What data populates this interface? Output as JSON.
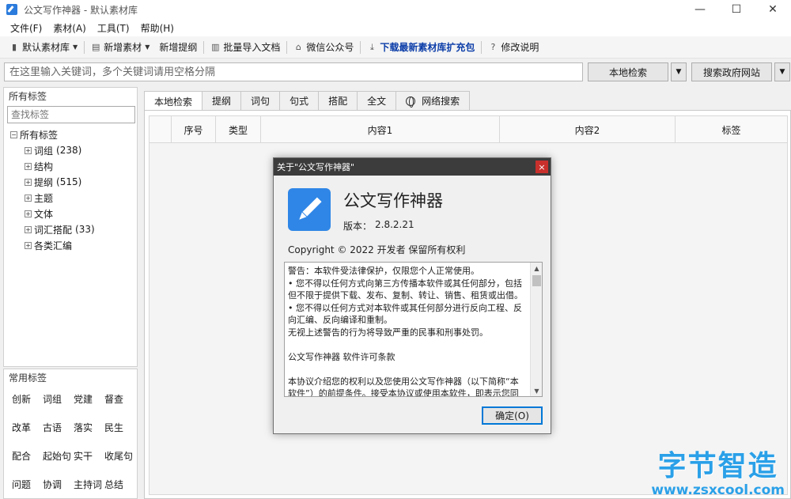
{
  "window": {
    "title": "公文写作神器  -  默认素材库",
    "controls": {
      "minimize": "—",
      "maximize": "☐",
      "close": "✕"
    }
  },
  "menu": [
    "文件(F)",
    "素材(A)",
    "工具(T)",
    "帮助(H)"
  ],
  "toolbar": {
    "library": "默认素材库",
    "add_material": "新增素材",
    "add_outline": "新增提纲",
    "batch_import": "批量导入文档",
    "wechat": "微信公众号",
    "download": "下载最新素材库扩充包",
    "changelog": "修改说明",
    "highlight_color": "#0b3da8"
  },
  "search": {
    "placeholder": "在这里输入关键词，多个关键词请用空格分隔",
    "local_button": "本地检索",
    "gov_button": "搜索政府网站"
  },
  "left_panel": {
    "caption": "所有标签",
    "search_placeholder": "查找标签",
    "root": "所有标签",
    "nodes": [
      {
        "label": "词组",
        "count": "(238)"
      },
      {
        "label": "结构",
        "count": ""
      },
      {
        "label": "提纲",
        "count": "(515)"
      },
      {
        "label": "主题",
        "count": ""
      },
      {
        "label": "文体",
        "count": ""
      },
      {
        "label": "词汇搭配",
        "count": "(33)"
      },
      {
        "label": "各类汇编",
        "count": ""
      }
    ]
  },
  "common_tags": {
    "caption": "常用标签",
    "items": [
      "创新",
      "词组",
      "党建",
      "督查",
      "改革",
      "古语",
      "落实",
      "民生",
      "配合",
      "起始句",
      "实干",
      "收尾句",
      "问题",
      "协调",
      "主持词",
      "总结"
    ]
  },
  "tabs": [
    "本地检索",
    "提纲",
    "词句",
    "句式",
    "搭配",
    "全文",
    "网络搜索"
  ],
  "table": {
    "headers": [
      "",
      "序号",
      "类型",
      "内容1",
      "内容2",
      "标签"
    ]
  },
  "dialog": {
    "title": "关于\"公文写作神器\"",
    "close": "×",
    "app_name": "公文写作神器",
    "version_label": "版本：",
    "version": "2.8.2.21",
    "copyright": "Copyright © 2022  开发者 保留所有权利",
    "license_lines": [
      "警告：本软件受法律保护，仅限您个人正常使用。",
      "• 您不得以任何方式向第三方传播本软件或其任何部分，包括",
      "但不限于提供下载、发布、复制、转让、销售、租赁或出借。",
      "• 您不得以任何方式对本软件或其任何部分进行反向工程、反",
      "向汇编、反向编译和重制。",
      "无视上述警告的行为将导致严重的民事和刑事处罚。",
      "",
      "公文写作神器 软件许可条款",
      "",
      "本协议介绍您的权利以及您使用公文写作神器（以下简称“本",
      "软件”）的前提条件。接受本协议或使用本软件，即表示您同"
    ],
    "ok_button": "确定(O)",
    "logo_color": "#2f86e6"
  },
  "watermark": {
    "title": "字节智造",
    "url": "www.zsxcool.com",
    "color": "#2aa0e8"
  }
}
